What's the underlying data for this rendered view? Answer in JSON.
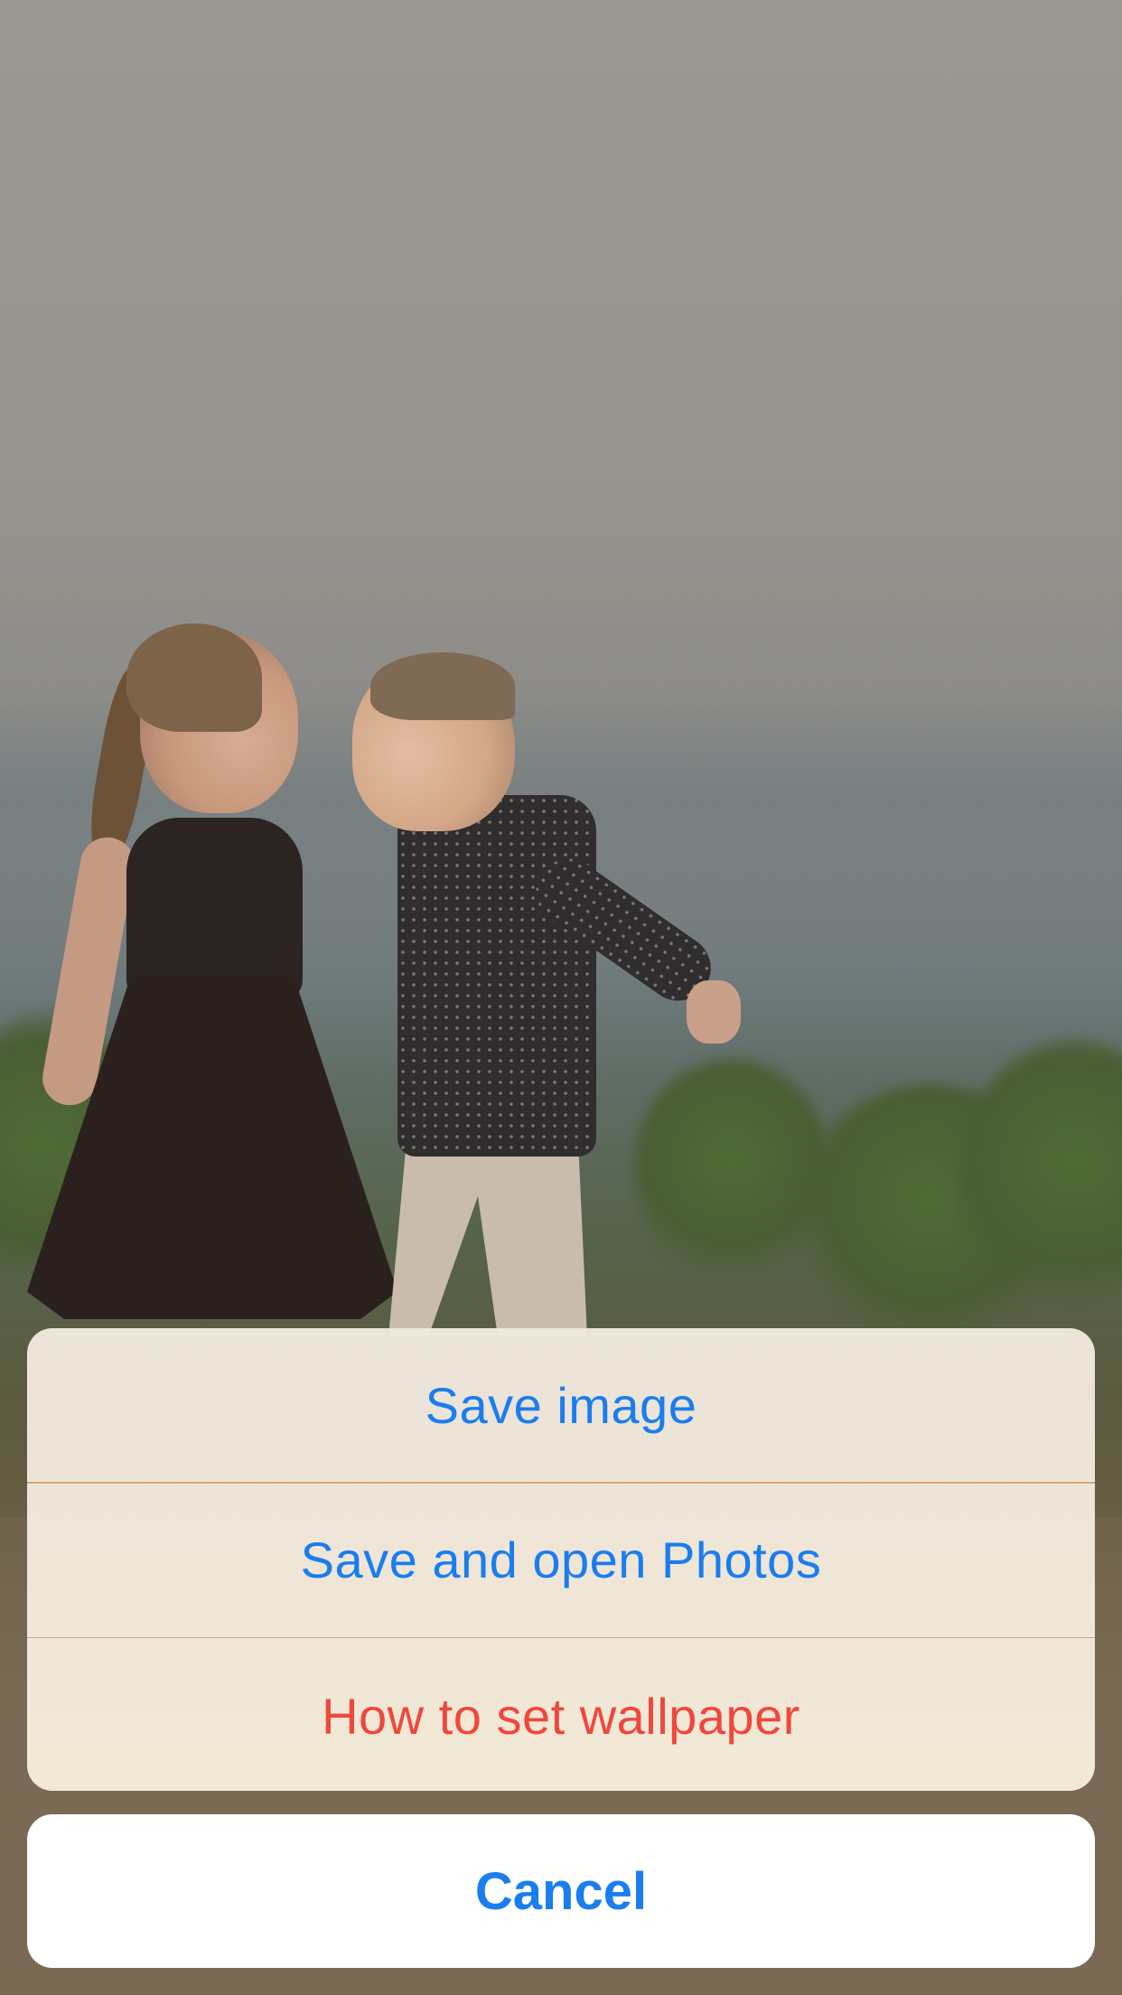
{
  "background": {
    "description_icon": "photo-wallpaper"
  },
  "action_sheet": {
    "items": [
      {
        "label": "Save image",
        "style": "default"
      },
      {
        "label": "Save and open Photos",
        "style": "default"
      },
      {
        "label": "How to set wallpaper",
        "style": "destructive"
      }
    ],
    "cancel_label": "Cancel"
  },
  "colors": {
    "accent": "#1a7df0",
    "destructive": "#f0473d",
    "sheet_background": "#f3e9dc",
    "divider": "#d2a770",
    "cancel_background": "#ffffff"
  }
}
